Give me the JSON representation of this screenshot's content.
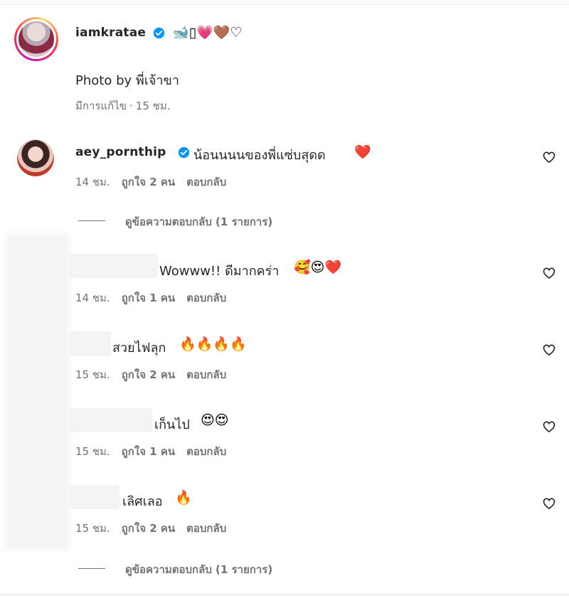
{
  "post": {
    "username": "iamkratae",
    "caption_emojis": "🐋▯💗🤎♡",
    "caption": "Photo by พี่เจ้าขา",
    "edited_label": "มีการแก้ไข",
    "time": "15 ชม."
  },
  "labels": {
    "reply": "ตอบกลับ",
    "view_replies": "ดูข้อความตอบกลับ (1 รายการ)"
  },
  "comments": [
    {
      "username": "aey_pornthip",
      "text": "น้อนนนนของพี่แซ่บสุดด",
      "emojis": "❤️",
      "time": "14 ชม.",
      "likes": "ถูกใจ 2 คน"
    },
    {
      "text": "Wowww!! ดีมากคร่า",
      "emojis": "🥰😍❤️",
      "time": "14 ชม.",
      "likes": "ถูกใจ 1 คน"
    },
    {
      "text": "สวยไฟลุก",
      "emojis": "🔥🔥🔥🔥",
      "time": "15 ชม.",
      "likes": "ถูกใจ 2 คน"
    },
    {
      "text": "เก็นไป",
      "emojis": "😍😍",
      "time": "15 ชม.",
      "likes": "ถูกใจ 1 คน"
    },
    {
      "text": "เลิศเลอ",
      "emojis": "🔥",
      "time": "15 ชม.",
      "likes": "ถูกใจ 2 คน"
    }
  ]
}
